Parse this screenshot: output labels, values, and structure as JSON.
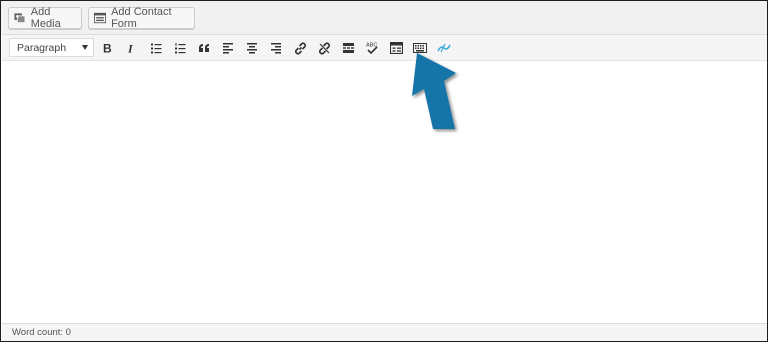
{
  "media_bar": {
    "add_media_label": "Add Media",
    "add_contact_form_label": "Add Contact Form"
  },
  "toolbar": {
    "format_select_value": "Paragraph",
    "spellcheck_text": "ABC",
    "buttons": [
      "bold",
      "italic",
      "bulleted-list",
      "numbered-list",
      "blockquote",
      "align-left",
      "align-center",
      "align-right",
      "insert-link",
      "remove-link",
      "read-more",
      "spellcheck",
      "toolbar-toggle",
      "keyboard",
      "wpforms"
    ]
  },
  "colors": {
    "arrow": "#1475a8",
    "accent_icon": "#2fa6d8"
  },
  "status": {
    "word_count_label": "Word count: 0"
  }
}
